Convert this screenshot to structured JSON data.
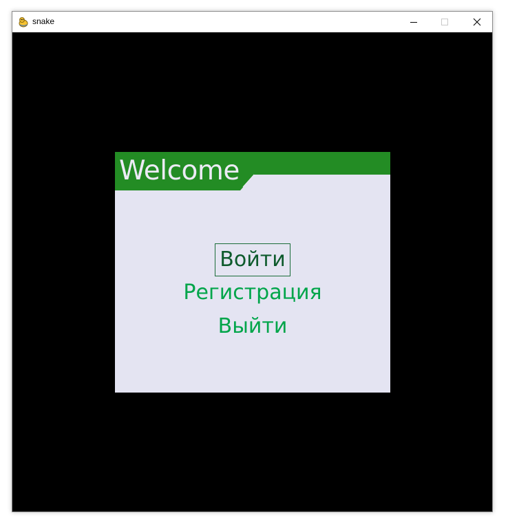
{
  "window": {
    "title": "snake",
    "icon": "pygame-snake-icon",
    "controls": [
      "minimize-icon",
      "maximize-icon",
      "close-icon"
    ]
  },
  "menu": {
    "header": "Welcome",
    "items": [
      {
        "label": "Войти",
        "selected": true
      },
      {
        "label": "Регистрация",
        "selected": false
      },
      {
        "label": "Выйти",
        "selected": false
      }
    ]
  },
  "colors": {
    "background": "#000000",
    "panel": "#e4e4f2",
    "header_bar": "#238c24",
    "header_text": "#ecebf6",
    "item_text": "#00a54a",
    "selected_text": "#0d5a2c",
    "selected_border": "#196c38"
  }
}
